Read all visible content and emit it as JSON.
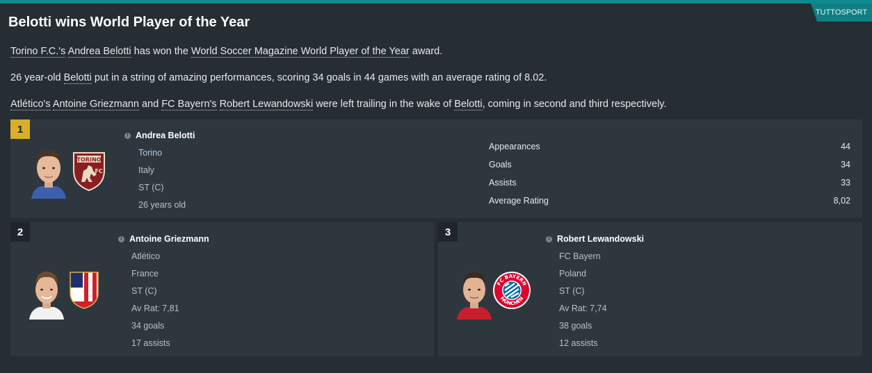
{
  "source": "TUTTOSPORT",
  "headline": "Belotti wins World Player of the Year",
  "paragraphs": {
    "p1": {
      "club": "Torino F.C.'s",
      "player": "Andrea Belotti",
      "mid": "has won the",
      "award": "World Soccer Magazine World Player of the Year",
      "end": "award."
    },
    "p2": {
      "start": "26 year-old",
      "player": "Belotti",
      "end": "put in a string of amazing performances, scoring 34 goals in 44 games with an average rating of 8.02."
    },
    "p3": {
      "club1": "Atlético's",
      "player1": "Antoine Griezmann",
      "and": "and",
      "club2": "FC Bayern's",
      "player2": "Robert Lewandowski",
      "mid": "were left trailing in the wake of",
      "player3": "Belotti",
      "end": ", coming in second and third respectively."
    }
  },
  "winner": {
    "rank": "1",
    "name": "Andrea Belotti",
    "club": "Torino",
    "nation": "Italy",
    "position": "ST (C)",
    "age": "26 years old",
    "crest_text": "TORINO",
    "crest_sub": "FC",
    "stats": [
      {
        "label": "Appearances",
        "value": "44"
      },
      {
        "label": "Goals",
        "value": "34"
      },
      {
        "label": "Assists",
        "value": "33"
      },
      {
        "label": "Average Rating",
        "value": "8,02"
      }
    ]
  },
  "second": {
    "rank": "2",
    "name": "Antoine Griezmann",
    "club": "Atlético",
    "nation": "France",
    "position": "ST (C)",
    "rating": "Av Rat: 7,81",
    "goals": "34 goals",
    "assists": "17 assists"
  },
  "third": {
    "rank": "3",
    "name": "Robert Lewandowski",
    "club": "FC Bayern",
    "nation": "Poland",
    "position": "ST (C)",
    "rating": "Av Rat: 7,74",
    "goals": "38 goals",
    "assists": "12 assists",
    "crest_top": "FC BAYERN",
    "crest_bottom": "MÜNCHEN"
  },
  "colors": {
    "accent": "#0f8a8f",
    "gold": "#d8ae2b",
    "panel": "#2f373e",
    "background": "#262d33"
  }
}
